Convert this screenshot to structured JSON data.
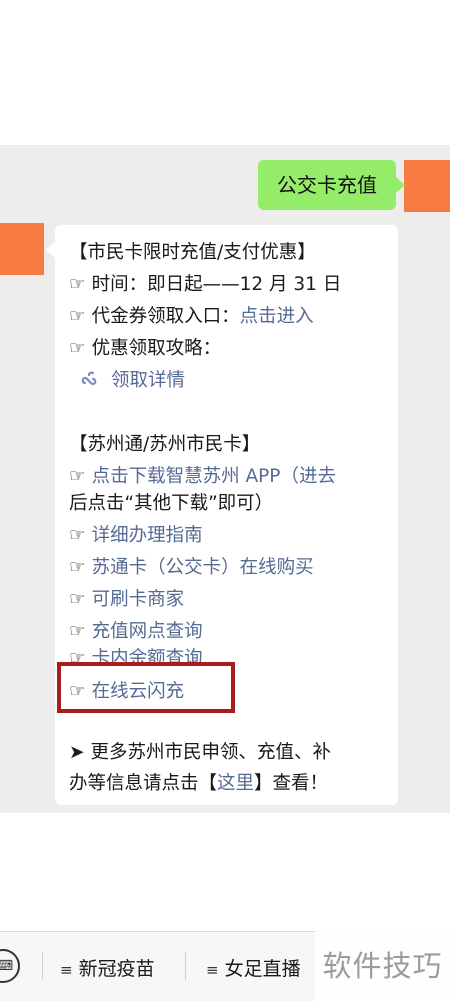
{
  "chat": {
    "user_message": "公交卡充值",
    "reply": {
      "section1_title": "【市民卡限时充值/支付优惠】",
      "time_line": "时间：即日起——12 月 31 日",
      "coupon_label": "代金券领取入口：",
      "coupon_link": "点击进入",
      "strategy_label": "优惠领取攻略：",
      "mini_program_link": "领取详情",
      "section2_title": "【苏州通/苏州市民卡】",
      "download_line1": "点击下载智慧苏州 APP（进去",
      "download_line2": "后点击“其他下载”即可）",
      "links": [
        "详细办理指南",
        "苏通卡（公交卡）在线购买",
        "可刷卡商家",
        "充值网点查询",
        "卡内余额查询",
        "在线云闪充"
      ],
      "more_line1": "更多苏州市民申领、充值、补",
      "more_prefix": "办等信息请点击【",
      "more_link": "这里",
      "more_suffix": "】查看！",
      "hand_glyph": "☞",
      "arrow_glyph": "➤"
    }
  },
  "bottom_menu": {
    "keyboard_icon": "keyboard-icon",
    "items": [
      "新冠疫苗",
      "女足直播"
    ],
    "menu_glyph": "≡"
  },
  "watermark": "软件技巧",
  "colors": {
    "user_bubble": "#95ec69",
    "link": "#566b94",
    "avatar": "#fa7a43",
    "highlight_border": "#a81e1e",
    "chat_background": "#ededed"
  }
}
